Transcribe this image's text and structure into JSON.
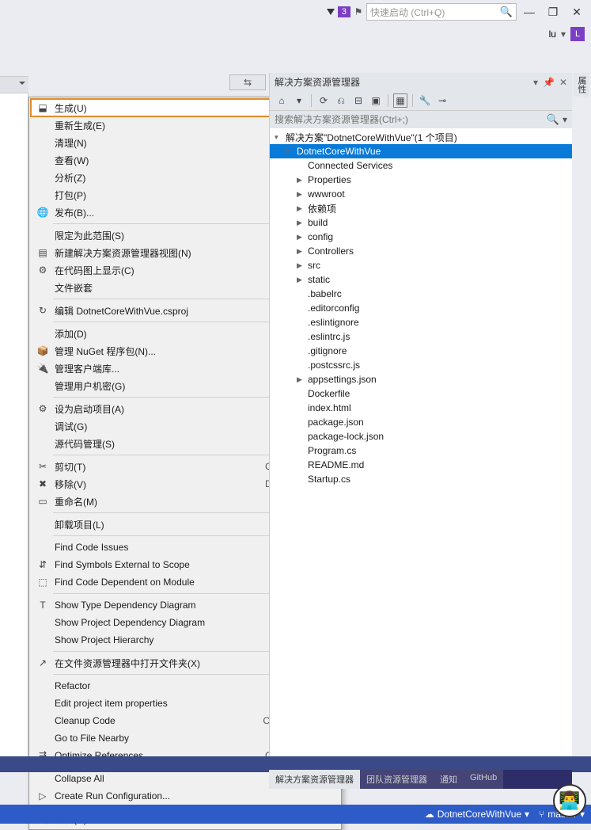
{
  "titlebar": {
    "notification_count": "3",
    "quicklaunch_placeholder": "快速启动 (Ctrl+Q)"
  },
  "user": {
    "name": "lu",
    "avatar_letter": "L"
  },
  "toolbar_arrow_icon": "↔",
  "context_menu": [
    {
      "icon": "build-icon",
      "label": "生成(U)",
      "highlighted": true
    },
    {
      "label": "重新生成(E)"
    },
    {
      "label": "清理(N)"
    },
    {
      "label": "查看(W)",
      "submenu": true
    },
    {
      "label": "分析(Z)",
      "submenu": true
    },
    {
      "label": "打包(P)"
    },
    {
      "icon": "publish-icon",
      "label": "发布(B)..."
    },
    {
      "sep": true
    },
    {
      "label": "限定为此范围(S)"
    },
    {
      "icon": "newview-icon",
      "label": "新建解决方案资源管理器视图(N)"
    },
    {
      "icon": "codemap-icon",
      "label": "在代码图上显示(C)"
    },
    {
      "label": "文件嵌套",
      "submenu": true
    },
    {
      "sep": true
    },
    {
      "icon": "edit-icon",
      "label": "编辑 DotnetCoreWithVue.csproj"
    },
    {
      "sep": true
    },
    {
      "label": "添加(D)",
      "submenu": true
    },
    {
      "icon": "nuget-icon",
      "label": "管理 NuGet 程序包(N)..."
    },
    {
      "icon": "clientlib-icon",
      "label": "管理客户端库..."
    },
    {
      "label": "管理用户机密(G)"
    },
    {
      "sep": true
    },
    {
      "icon": "gear-icon",
      "label": "设为启动项目(A)"
    },
    {
      "label": "调试(G)",
      "submenu": true
    },
    {
      "label": "源代码管理(S)",
      "submenu": true
    },
    {
      "sep": true
    },
    {
      "icon": "cut-icon",
      "label": "剪切(T)",
      "shortcut": "Ctrl+X"
    },
    {
      "icon": "delete-icon",
      "label": "移除(V)",
      "shortcut": "Del"
    },
    {
      "icon": "rename-icon",
      "label": "重命名(M)"
    },
    {
      "sep": true
    },
    {
      "label": "卸载项目(L)"
    },
    {
      "sep": true
    },
    {
      "label": "Find Code Issues"
    },
    {
      "icon": "findsym-icon",
      "label": "Find Symbols External to Scope"
    },
    {
      "icon": "finddep-icon",
      "label": "Find Code Dependent on Module"
    },
    {
      "sep": true
    },
    {
      "icon": "typedep-icon",
      "label": "Show Type Dependency Diagram"
    },
    {
      "label": "Show Project Dependency Diagram"
    },
    {
      "label": "Show Project Hierarchy"
    },
    {
      "sep": true
    },
    {
      "icon": "openfolder-icon",
      "label": "在文件资源管理器中打开文件夹(X)"
    },
    {
      "sep": true
    },
    {
      "label": "Refactor",
      "submenu": true
    },
    {
      "label": "Edit project item properties"
    },
    {
      "label": "Cleanup Code",
      "shortcut": "Ctrl+E, Ctrl+C"
    },
    {
      "label": "Go to File Nearby"
    },
    {
      "icon": "optref-icon",
      "label": "Optimize References...",
      "shortcut": "Ctrl+Alt+Y"
    },
    {
      "sep": true
    },
    {
      "label": "Collapse All"
    },
    {
      "icon": "runconfig-icon",
      "label": "Create Run Configuration..."
    },
    {
      "sep": true
    },
    {
      "icon": "wrench-icon",
      "label": "属性(R)",
      "shortcut": "Alt+Enter"
    }
  ],
  "solution_explorer": {
    "title": "解决方案资源管理器",
    "search_placeholder": "搜索解决方案资源管理器(Ctrl+;)",
    "solution_label": "解决方案\"DotnetCoreWithVue\"(1 个项目)",
    "selected_project": "DotnetCoreWithVue",
    "items": [
      {
        "label": "Connected Services",
        "indent": 2
      },
      {
        "label": "Properties",
        "indent": 2,
        "twisty": "▶"
      },
      {
        "label": "wwwroot",
        "indent": 2,
        "twisty": "▶"
      },
      {
        "label": "依赖项",
        "indent": 2,
        "twisty": "▶"
      },
      {
        "label": "build",
        "indent": 2,
        "twisty": "▶"
      },
      {
        "label": "config",
        "indent": 2,
        "twisty": "▶"
      },
      {
        "label": "Controllers",
        "indent": 2,
        "twisty": "▶"
      },
      {
        "label": "src",
        "indent": 2,
        "twisty": "▶"
      },
      {
        "label": "static",
        "indent": 2,
        "twisty": "▶"
      },
      {
        "label": ".babelrc",
        "indent": 2
      },
      {
        "label": ".editorconfig",
        "indent": 2
      },
      {
        "label": ".eslintignore",
        "indent": 2
      },
      {
        "label": ".eslintrc.js",
        "indent": 2
      },
      {
        "label": ".gitignore",
        "indent": 2
      },
      {
        "label": ".postcssrc.js",
        "indent": 2
      },
      {
        "label": "appsettings.json",
        "indent": 2,
        "twisty": "▶"
      },
      {
        "label": "Dockerfile",
        "indent": 2
      },
      {
        "label": "index.html",
        "indent": 2
      },
      {
        "label": "package.json",
        "indent": 2
      },
      {
        "label": "package-lock.json",
        "indent": 2
      },
      {
        "label": "Program.cs",
        "indent": 2
      },
      {
        "label": "README.md",
        "indent": 2
      },
      {
        "label": "Startup.cs",
        "indent": 2
      }
    ]
  },
  "side_tab": "属性",
  "bottom_tabs": [
    "解决方案资源管理器",
    "团队资源管理器",
    "通知",
    "GitHub"
  ],
  "statusbar": {
    "project": "DotnetCoreWithVue",
    "branch": "master"
  }
}
